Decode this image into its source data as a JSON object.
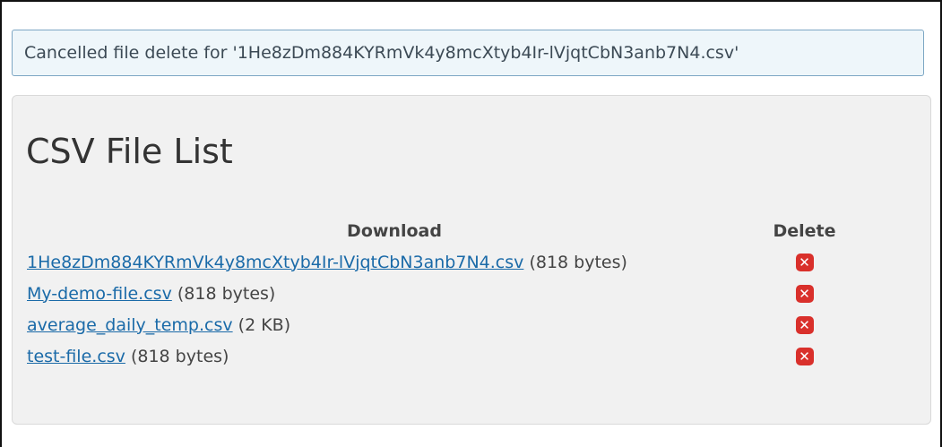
{
  "notice": {
    "message": "Cancelled file delete for '1He8zDm884KYRmVk4y8mcXtyb4Ir-lVjqtCbN3anb7N4.csv'"
  },
  "panel": {
    "title": "CSV File List"
  },
  "table": {
    "headers": {
      "download": "Download",
      "delete": "Delete"
    },
    "rows": [
      {
        "filename": "1He8zDm884KYRmVk4y8mcXtyb4Ir-lVjqtCbN3anb7N4.csv",
        "size": "(818 bytes)"
      },
      {
        "filename": "My-demo-file.csv",
        "size": "(818 bytes)"
      },
      {
        "filename": "average_daily_temp.csv",
        "size": "(2 KB)"
      },
      {
        "filename": "test-file.csv",
        "size": "(818 bytes)"
      }
    ]
  },
  "icons": {
    "delete": "close-icon"
  },
  "colors": {
    "link": "#1a6aa8",
    "delete_button": "#d9302b",
    "notice_background": "#eef6fa",
    "notice_border": "#7da7c4",
    "panel_background": "#f1f1f1"
  }
}
